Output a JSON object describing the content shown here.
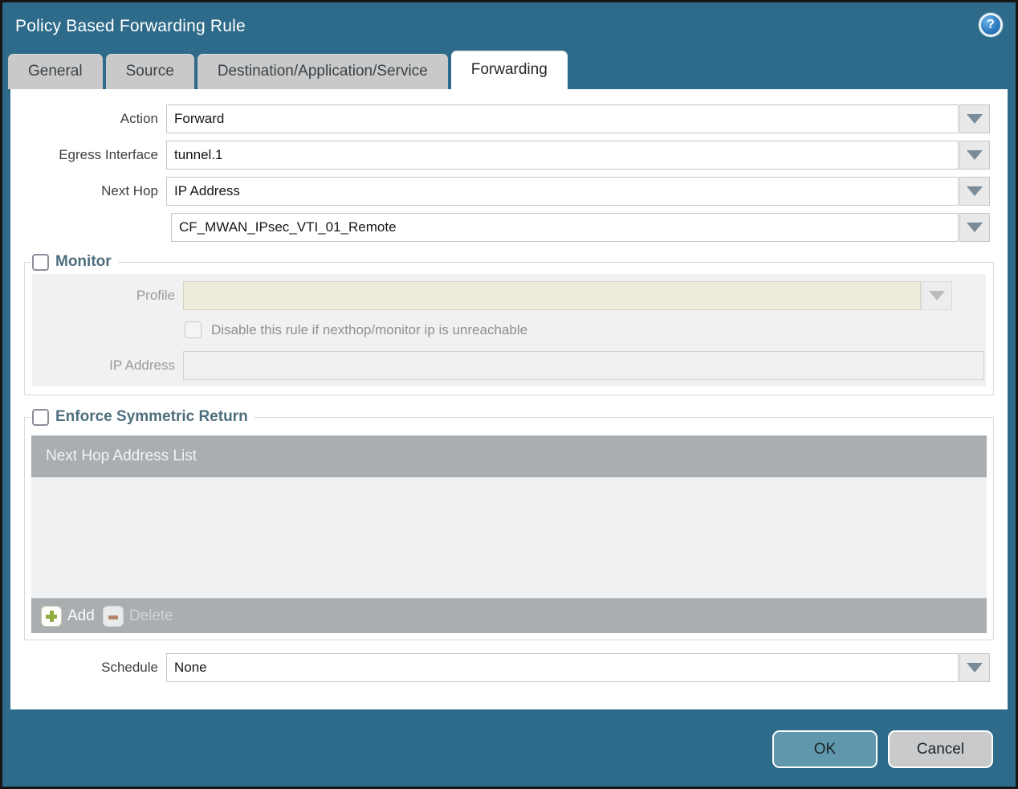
{
  "dialog": {
    "title": "Policy Based Forwarding Rule",
    "help_glyph": "?"
  },
  "tabs": [
    {
      "label": "General",
      "active": false
    },
    {
      "label": "Source",
      "active": false
    },
    {
      "label": "Destination/Application/Service",
      "active": false
    },
    {
      "label": "Forwarding",
      "active": true
    }
  ],
  "form": {
    "action": {
      "label": "Action",
      "value": "Forward"
    },
    "egress_interface": {
      "label": "Egress Interface",
      "value": "tunnel.1"
    },
    "next_hop": {
      "label": "Next Hop",
      "value": "IP Address"
    },
    "next_hop_value": {
      "value": "CF_MWAN_IPsec_VTI_01_Remote"
    },
    "schedule": {
      "label": "Schedule",
      "value": "None"
    }
  },
  "monitor": {
    "legend": "Monitor",
    "checked": false,
    "profile": {
      "label": "Profile",
      "value": ""
    },
    "disable_rule": {
      "label": "Disable this rule if nexthop/monitor ip is unreachable",
      "checked": false
    },
    "ip_address": {
      "label": "IP Address",
      "value": ""
    }
  },
  "symmetric_return": {
    "legend": "Enforce Symmetric Return",
    "checked": false,
    "table": {
      "header": "Next Hop Address List",
      "rows": [],
      "add_label": "Add",
      "delete_label": "Delete",
      "delete_enabled": false
    }
  },
  "footer": {
    "ok_label": "OK",
    "cancel_label": "Cancel"
  },
  "colors": {
    "chrome_teal": "#2e6b8a",
    "active_tab_bg": "#ffffff",
    "inactive_tab_bg": "#c9c9c9",
    "panel_gray": "#f1f1f1",
    "disabled_field_beige": "#f0ecdb",
    "table_chrome_gray": "#aaaeb0",
    "ok_button_bg": "#6097ad",
    "cancel_button_bg": "#c8cacc",
    "section_legend_text": "#4e6e7d",
    "add_icon_green": "#8fae3e",
    "delete_icon_red": "#b5846f"
  }
}
